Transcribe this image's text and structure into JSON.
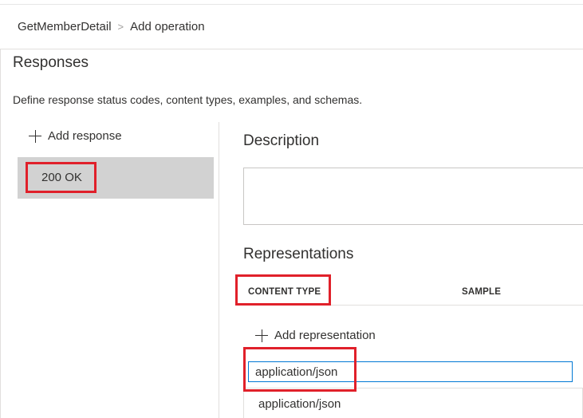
{
  "breadcrumb": {
    "parent": "GetMemberDetail",
    "separator": ">",
    "current": "Add operation"
  },
  "responses": {
    "title": "Responses",
    "description": "Define response status codes, content types, examples, and schemas.",
    "add_label": "Add response",
    "items": [
      {
        "label": "200 OK",
        "selected": true
      }
    ]
  },
  "detail": {
    "description_title": "Description",
    "description_value": "",
    "representations_title": "Representations",
    "columns": [
      "CONTENT TYPE",
      "SAMPLE"
    ],
    "add_representation_label": "Add representation",
    "content_type_input_value": "application/json",
    "suggestions": [
      "application/json"
    ]
  },
  "colors": {
    "highlight": "#e0202a",
    "selected_bg": "#d2d2d2",
    "focus_border": "#0078d4"
  }
}
